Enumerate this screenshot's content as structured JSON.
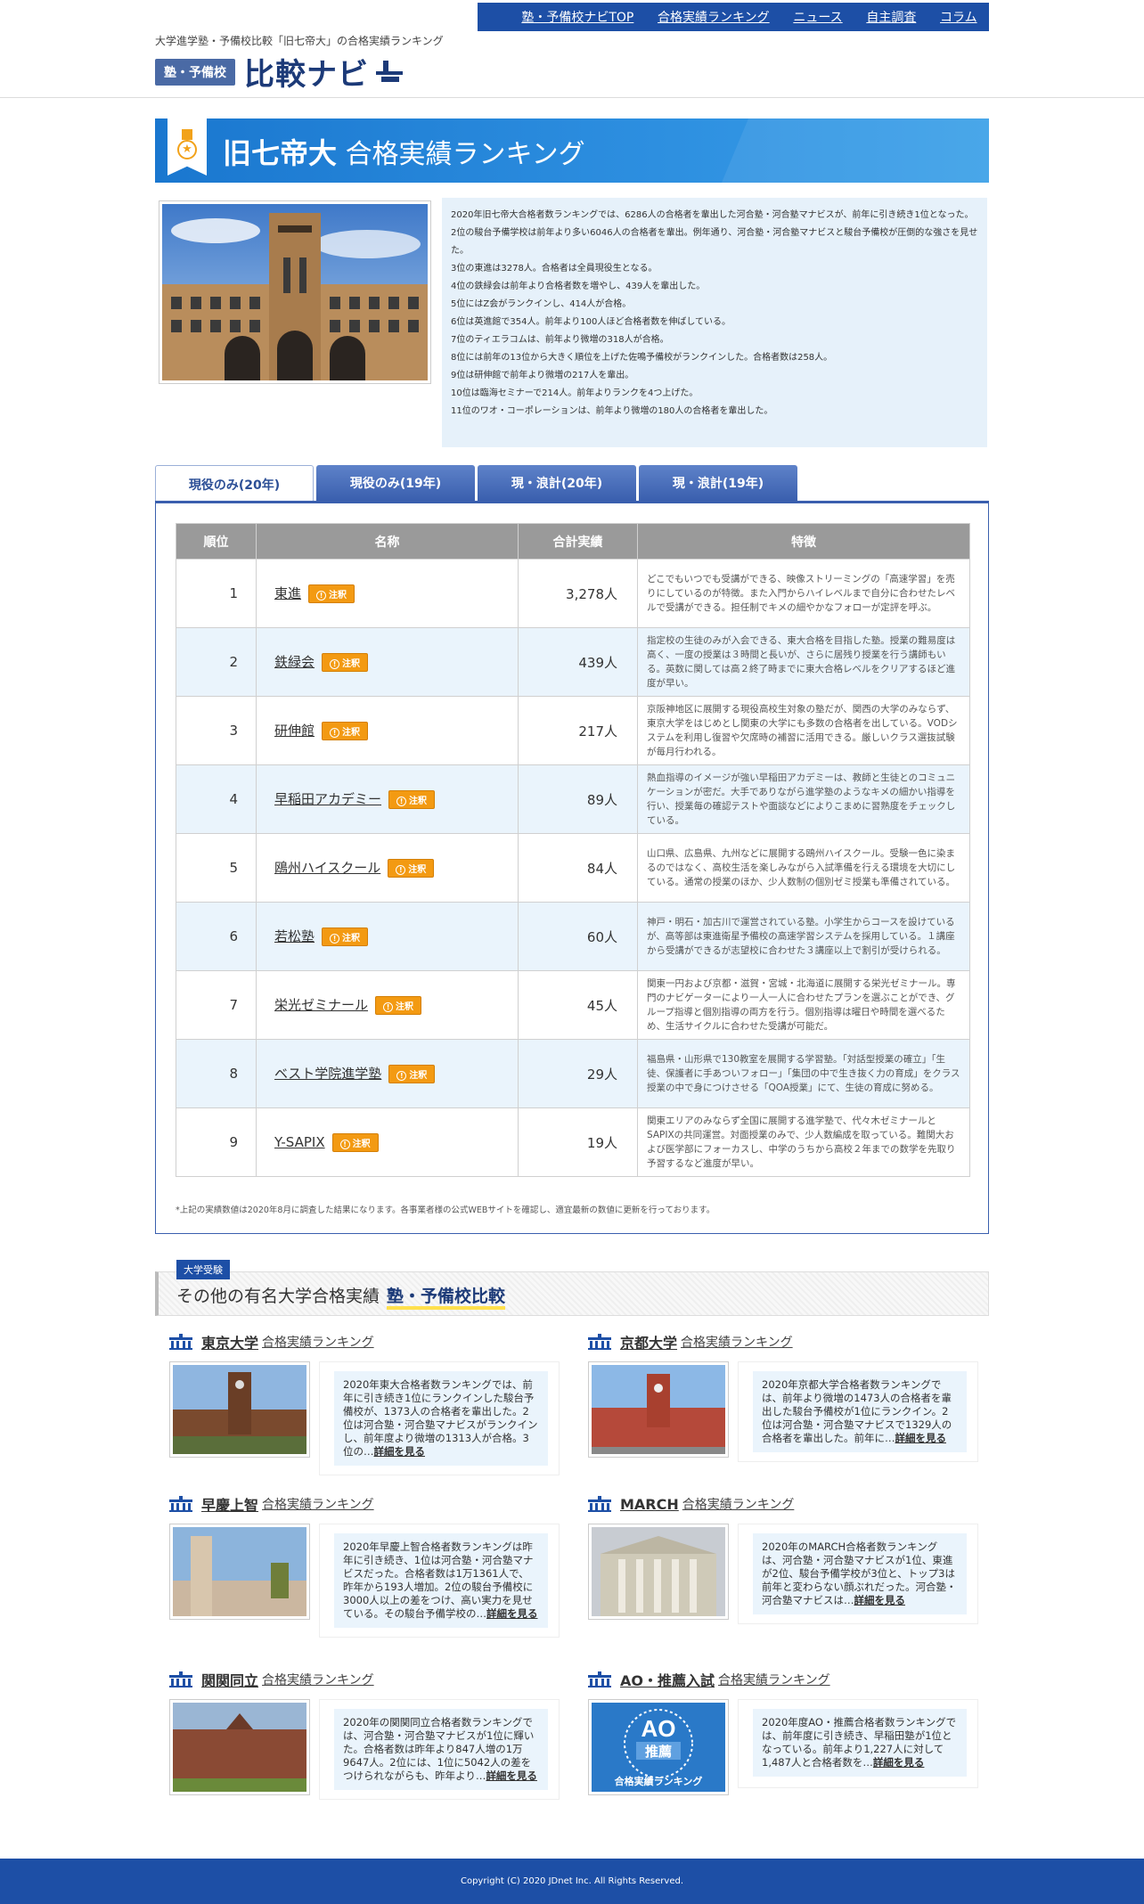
{
  "header": {
    "tagline": "大学進学塾・予備校比較「旧七帝大」の合格実績ランキング",
    "logo_badge": "塾・予備校",
    "logo_text": "比較ナビ",
    "nav": [
      "塾・予備校ナビTOP",
      "合格実績ランキング",
      "ニュース",
      "自主調査",
      "コラム"
    ]
  },
  "banner": {
    "title_bold": "旧七帝大",
    "title_rest": "合格実績ランキング"
  },
  "intro": {
    "lines": [
      "2020年旧七帝大合格者数ランキングでは、6286人の合格者を輩出した河合塾・河合塾マナビスが、前年に引き続き1位となった。",
      "2位の駿台予備学校は前年より多い6046人の合格者を輩出。例年通り、河合塾・河合塾マナビスと駿台予備校が圧倒的な強さを見せた。",
      "3位の東進は3278人。合格者は全員現役生となる。",
      "4位の鉄緑会は前年より合格者数を増やし、439人を輩出した。",
      "5位にはZ会がランクインし、414人が合格。",
      "6位は英進館で354人。前年より100人ほど合格者数を伸ばしている。",
      "7位のティエラコムは、前年より微増の318人が合格。",
      "8位には前年の13位から大きく順位を上げた佐鳴予備校がランクインした。合格者数は258人。",
      "9位は研伸館で前年より微増の217人を輩出。",
      "10位は臨海セミナーで214人。前年よりランクを4つ上げた。",
      "11位のワオ・コーポレーションは、前年より微増の180人の合格者を輩出した。"
    ]
  },
  "tabs": [
    "現役のみ(20年)",
    "現役のみ(19年)",
    "現・浪計(20年)",
    "現・浪計(19年)"
  ],
  "table": {
    "headers": [
      "順位",
      "名称",
      "合計実績",
      "特徴"
    ],
    "note_label": "注釈",
    "rows": [
      {
        "rank": "1",
        "name": "東進",
        "total": "3,278人",
        "feature": "どこでもいつでも受講ができる、映像ストリーミングの「高速学習」を売りにしているのが特徴。また入門からハイレベルまで自分に合わせたレベルで受講ができる。担任制でキメの細やかなフォローが定評を呼ぶ。"
      },
      {
        "rank": "2",
        "name": "鉄緑会",
        "total": "439人",
        "feature": "指定校の生徒のみが入会できる、東大合格を目指した塾。授業の難易度は高く、一度の授業は３時間と長いが、さらに居残り授業を行う講師もいる。英数に関しては高２終了時までに東大合格レベルをクリアするほど進度が早い。"
      },
      {
        "rank": "3",
        "name": "研伸館",
        "total": "217人",
        "feature": "京阪神地区に展開する現役高校生対象の塾だが、関西の大学のみならず、東京大学をはじめとし関東の大学にも多数の合格者を出している。VODシステムを利用し復習や欠席時の補習に活用できる。厳しいクラス選抜試験が毎月行われる。"
      },
      {
        "rank": "4",
        "name": "早稲田アカデミー",
        "total": "89人",
        "feature": "熱血指導のイメージが強い早稲田アカデミーは、教師と生徒とのコミュニケーションが密だ。大手でありながら進学塾のようなキメの細かい指導を行い、授業毎の確認テストや面談などによりこまめに習熟度をチェックしている。"
      },
      {
        "rank": "5",
        "name": "鴎州ハイスクール",
        "total": "84人",
        "feature": "山口県、広島県、九州などに展開する鴎州ハイスクール。受験一色に染まるのではなく、高校生活を楽しみながら入試準備を行える環境を大切にしている。通常の授業のほか、少人数制の個別ゼミ授業も準備されている。"
      },
      {
        "rank": "6",
        "name": "若松塾",
        "total": "60人",
        "feature": "神戸・明石・加古川で運営されている塾。小学生からコースを設けているが、高等部は東進衛星予備校の高速学習システムを採用している。１講座から受講ができるが志望校に合わせた３講座以上で割引が受けられる。"
      },
      {
        "rank": "7",
        "name": "栄光ゼミナール",
        "total": "45人",
        "feature": "関東一円および京都・滋賀・宮城・北海道に展開する栄光ゼミナール。専門のナビゲーターにより一人一人に合わせたプランを選ぶことができ、グループ指導と個別指導の両方を行う。個別指導は曜日や時間を選べるため、生活サイクルに合わせた受講が可能だ。"
      },
      {
        "rank": "8",
        "name": "ベスト学院進学塾",
        "total": "29人",
        "feature": "福島県・山形県で130教室を展開する学習塾。「対話型授業の確立」「生徒、保護者に手あついフォロー」「集団の中で生き抜く力の育成」をクラス授業の中で身につけさせる「QOA授業」にて、生徒の育成に努める。"
      },
      {
        "rank": "9",
        "name": "Y-SAPIX",
        "total": "19人",
        "feature": "関東エリアのみならず全国に展開する進学塾で、代々木ゼミナールとSAPIXの共同運営。対面授業のみで、少人数編成を取っている。難関大および医学部にフォーカスし、中学のうちから高校２年までの数学を先取り予習するなど進度が早い。"
      }
    ],
    "footnote": "*上記の実績数値は2020年8月に調査した結果になります。各事業者様の公式WEBサイトを確認し、適宜最新の数値に更新を行っております。"
  },
  "other": {
    "tag": "大学受験",
    "title": "その他の有名大学合格実績",
    "title_em": "塾・予備校比較",
    "suffix": "合格実績ランキング",
    "more": "詳細を見る",
    "cards": [
      {
        "name": "東京大学",
        "text": "2020年東大合格者数ランキングでは、前年に引き続き1位にランクインした駿台予備校が、1373人の合格者を輩出した。2位は河合塾・河合塾マナビスがランクインし、前年度より微増の1313人が合格。3位の…"
      },
      {
        "name": "京都大学",
        "text": "2020年京都大学合格者数ランキングでは、前年より微増の1473人の合格者を輩出した駿台予備校が1位にランクイン。2位は河合塾・河合塾マナビスで1329人の合格者を輩出した。前年に…"
      },
      {
        "name": "早慶上智",
        "text": "2020年早慶上智合格者数ランキングは昨年に引き続き、1位は河合塾・河合塾マナビスだった。合格者数は1万1361人で、昨年から193人増加。2位の駿台予備校に3000人以上の差をつけ、高い実力を見せている。その駿台予備学校の…"
      },
      {
        "name": "MARCH",
        "text": "2020年のMARCH合格者数ランキングは、河合塾・河合塾マナビスが1位、東進が2位、駿台予備学校が3位と、トップ3は前年と変わらない顔ぶれだった。河合塾・河合塾マナビスは…"
      },
      {
        "name": "関関同立",
        "text": "2020年の関関同立合格者数ランキングでは、河合塾・河合塾マナビスが1位に輝いた。合格者数は昨年より847人増の1万9647人。2位には、1位に5042人の差をつけられながらも、昨年より…"
      },
      {
        "name": "AO・推薦入試",
        "text": "2020年度AO・推薦合格者数ランキングでは、前年度に引き続き、早稲田塾が1位となっている。前年より1,227人に対して1,487人と合格者数を…"
      }
    ]
  },
  "ao_image": {
    "big": "AO",
    "mid": "推薦",
    "small": "合格実績ランキング"
  },
  "footer": "Copyright (C) 2020 JDnet Inc. All Rights Reserved.",
  "colors": {
    "brand": "#1d4fa6",
    "accent": "#f39a12",
    "highlight": "#ffe04d"
  }
}
